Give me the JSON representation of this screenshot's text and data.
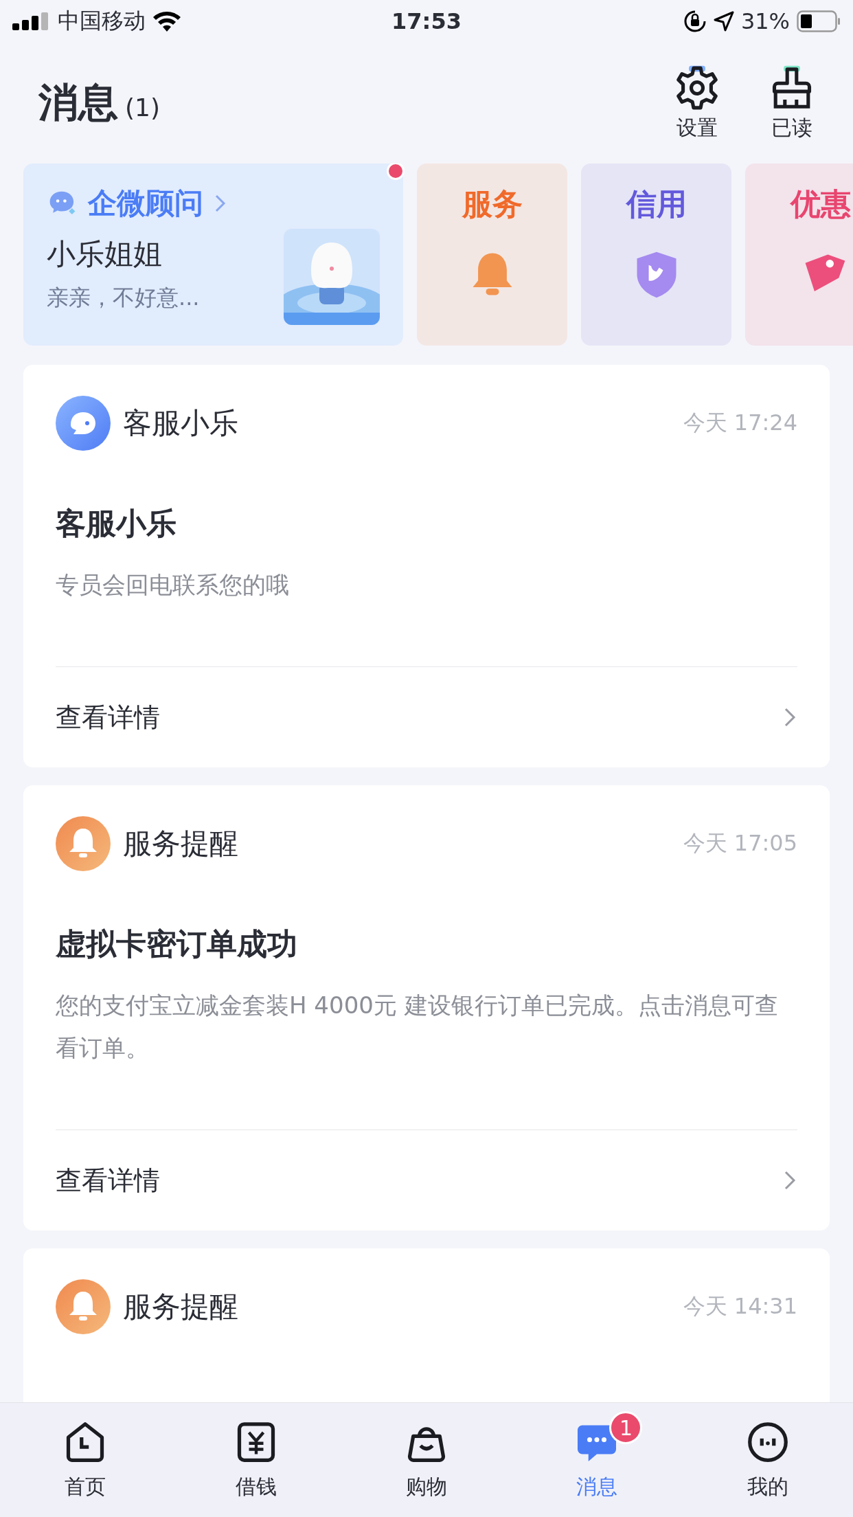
{
  "status_bar": {
    "carrier": "中国移动",
    "time": "17:53",
    "battery": "31%"
  },
  "header": {
    "title": "消息",
    "count": "(1)",
    "actions": [
      {
        "kind": "settings",
        "label": "设置"
      },
      {
        "kind": "clear",
        "label": "已读"
      }
    ]
  },
  "advisor": {
    "title": "企微顾问",
    "name": "小乐姐姐",
    "preview": "亲亲，不好意...",
    "unread": true
  },
  "categories": [
    {
      "kind": "bell",
      "label": "服务",
      "color": "#f06a2a"
    },
    {
      "kind": "shield",
      "label": "信用",
      "color": "#6259dc"
    },
    {
      "kind": "tag",
      "label": "优惠",
      "color": "#e8456f"
    }
  ],
  "messages": [
    {
      "kind": "support",
      "sender": "客服小乐",
      "time": "今天 17:24",
      "title": "客服小乐",
      "body": "专员会回电联系您的哦",
      "link": "查看详情"
    },
    {
      "kind": "service",
      "sender": "服务提醒",
      "time": "今天 17:05",
      "title": "虚拟卡密订单成功",
      "body": "您的支付宝立减金套装H 4000元 建设银行订单已完成。点击消息可查看订单。",
      "link": "查看详情"
    },
    {
      "kind": "service",
      "sender": "服务提醒",
      "time": "今天 14:31"
    }
  ],
  "tabs": [
    {
      "kind": "home",
      "label": "首页",
      "selected": false
    },
    {
      "kind": "loan",
      "label": "借钱",
      "selected": false
    },
    {
      "kind": "shop",
      "label": "购物",
      "selected": false
    },
    {
      "kind": "message",
      "label": "消息",
      "selected": true,
      "badge": "1"
    },
    {
      "kind": "me",
      "label": "我的",
      "selected": false
    }
  ]
}
